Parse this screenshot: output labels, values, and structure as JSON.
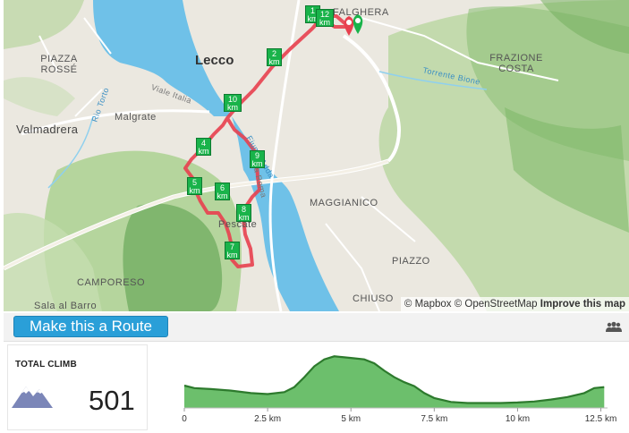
{
  "map": {
    "places": [
      {
        "name": "Lecco",
        "cls": "big"
      },
      {
        "name": "Malgrate",
        "cls": ""
      },
      {
        "name": "Valmadrera",
        "cls": "med"
      },
      {
        "name": "PIAZZA ROSSÉ",
        "cls": ""
      },
      {
        "name": "FALGHERA",
        "cls": ""
      },
      {
        "name": "FRAZIONE COSTA",
        "cls": ""
      },
      {
        "name": "MAGGIANICO",
        "cls": ""
      },
      {
        "name": "PIAZZO",
        "cls": ""
      },
      {
        "name": "CHIUSO",
        "cls": ""
      },
      {
        "name": "CAMPORESO",
        "cls": ""
      },
      {
        "name": "Sala al Barro",
        "cls": ""
      },
      {
        "name": "Pescate",
        "cls": ""
      },
      {
        "name": "Fiume Adda",
        "cls": ""
      },
      {
        "name": "Torrente Bione",
        "cls": ""
      },
      {
        "name": "Rio Torto",
        "cls": ""
      },
      {
        "name": "Viale Italia",
        "cls": ""
      },
      {
        "name": "Via Roma",
        "cls": ""
      }
    ],
    "km_markers": [
      {
        "label": "1",
        "unit": "km"
      },
      {
        "label": "12",
        "unit": "km"
      },
      {
        "label": "2",
        "unit": "km"
      },
      {
        "label": "10",
        "unit": "km"
      },
      {
        "label": "4",
        "unit": "km"
      },
      {
        "label": "9",
        "unit": "km"
      },
      {
        "label": "5",
        "unit": "km"
      },
      {
        "label": "6",
        "unit": "km"
      },
      {
        "label": "8",
        "unit": "km"
      },
      {
        "label": "7",
        "unit": "km"
      }
    ],
    "attribution": {
      "mapbox": "© Mapbox",
      "osm": "© OpenStreetMap",
      "improve": "Improve this map"
    },
    "colors": {
      "route": "#e8404f",
      "water": "#6fc1e8",
      "marker": "#19b34a"
    }
  },
  "toolbar": {
    "make_route_label": "Make this a Route",
    "people_icon": "people-icon"
  },
  "climb": {
    "title": "TOTAL CLIMB",
    "value": "501",
    "icon": "mountain-icon"
  },
  "chart_data": {
    "type": "area",
    "x": [
      0,
      0.3,
      0.8,
      1.4,
      2.0,
      2.5,
      3.0,
      3.3,
      3.6,
      3.9,
      4.2,
      4.5,
      4.8,
      5.1,
      5.4,
      5.7,
      6.0,
      6.3,
      6.6,
      6.9,
      7.2,
      7.5,
      8.0,
      8.5,
      9.0,
      9.5,
      10.0,
      10.5,
      11.0,
      11.5,
      12.0,
      12.3,
      12.6
    ],
    "y": [
      45,
      40,
      38,
      35,
      30,
      28,
      32,
      42,
      62,
      84,
      98,
      104,
      102,
      100,
      98,
      90,
      75,
      62,
      52,
      44,
      30,
      20,
      12,
      10,
      10,
      10,
      11,
      13,
      17,
      22,
      30,
      40,
      42
    ],
    "xticks": [
      "0",
      "2.5 km",
      "5 km",
      "7.5 km",
      "10 km",
      "12.5 km"
    ],
    "xtick_values": [
      0,
      2.5,
      5,
      7.5,
      10,
      12.5
    ],
    "xlim": [
      0,
      12.7
    ],
    "ylim": [
      0,
      110
    ],
    "title": "",
    "xlabel": "",
    "ylabel": "",
    "fill_color": "#5cb85c",
    "line_color": "#2d7a2d"
  }
}
